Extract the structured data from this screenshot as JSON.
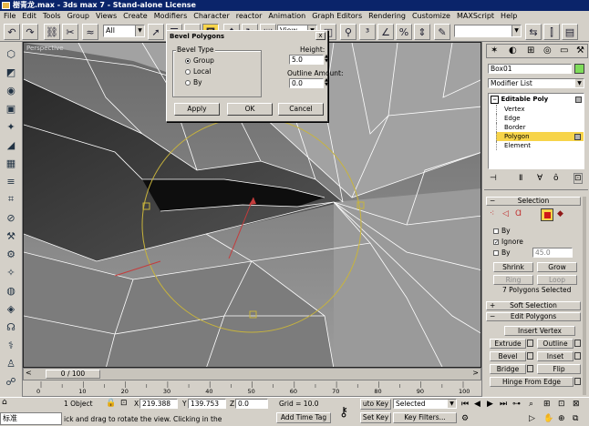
{
  "window": {
    "title": "樹青龙.max - 3ds max 7 - Stand-alone License"
  },
  "menu": [
    "File",
    "Edit",
    "Tools",
    "Group",
    "Views",
    "Create",
    "Modifiers",
    "Character",
    "reactor",
    "Animation",
    "Graph Editors",
    "Rendering",
    "Customize",
    "MAXScript",
    "Help"
  ],
  "toolbar": {
    "selection_filter": "All",
    "ref_coord": "View",
    "named_sel": ""
  },
  "viewport": {
    "label": "Perspective"
  },
  "dialog": {
    "title": "Bevel Polygons",
    "close": "x",
    "bevel_type_label": "Bevel Type",
    "options": [
      "Group",
      "Local",
      "By"
    ],
    "selected_option": "Group",
    "height_label": "Height:",
    "height_value": "5.0",
    "outline_label": "Outline Amount:",
    "outline_value": "0.0",
    "apply_label": "Apply",
    "ok_label": "OK",
    "cancel_label": "Cancel"
  },
  "command_panel": {
    "object_name": "Box01",
    "modifier_list": "Modifier List",
    "stack": {
      "root": "Editable Poly",
      "items": [
        "Vertex",
        "Edge",
        "Border",
        "Polygon",
        "Element"
      ],
      "selected": "Polygon"
    },
    "selection": {
      "header": "Selection",
      "by_vertex": "By",
      "ignore_backfacing": "Ignore",
      "by_angle": "By",
      "angle_value": "45.0",
      "shrink": "Shrink",
      "grow": "Grow",
      "ring": "Ring",
      "loop": "Loop",
      "status": "7 Polygons Selected"
    },
    "soft_selection": "Soft Selection",
    "edit_polygons": {
      "header": "Edit Polygons",
      "insert_vertex": "Insert Vertex",
      "extrude": "Extrude",
      "outline": "Outline",
      "bevel": "Bevel",
      "inset": "Inset",
      "bridge": "Bridge",
      "flip": "Flip",
      "hinge": "Hinge From Edge"
    }
  },
  "timeline": {
    "slider": "0 / 100",
    "ticks": [
      "0",
      "10",
      "20",
      "30",
      "40",
      "50",
      "60",
      "70",
      "80",
      "90",
      "100"
    ]
  },
  "status": {
    "selection_count": "1 Object",
    "x_label": "X",
    "x_value": "219.388",
    "y_label": "Y",
    "y_value": "139.753",
    "z_label": "Z",
    "z_value": "0.0",
    "grid": "Grid = 10.0",
    "prompt_prefix": "标准",
    "prompt": "ick and drag to rotate the view.  Clicking in the",
    "add_time_tag": "Add Time Tag",
    "auto_key": "uto Key",
    "set_key": "Set Key",
    "selected": "Selected",
    "key_filters": "Key Filters..."
  },
  "colors": {
    "title_bg": "#0a246a",
    "accent_yellow": "#f7d44a",
    "mesh_line": "#ffffff",
    "gizmo": "#c8b43c"
  }
}
